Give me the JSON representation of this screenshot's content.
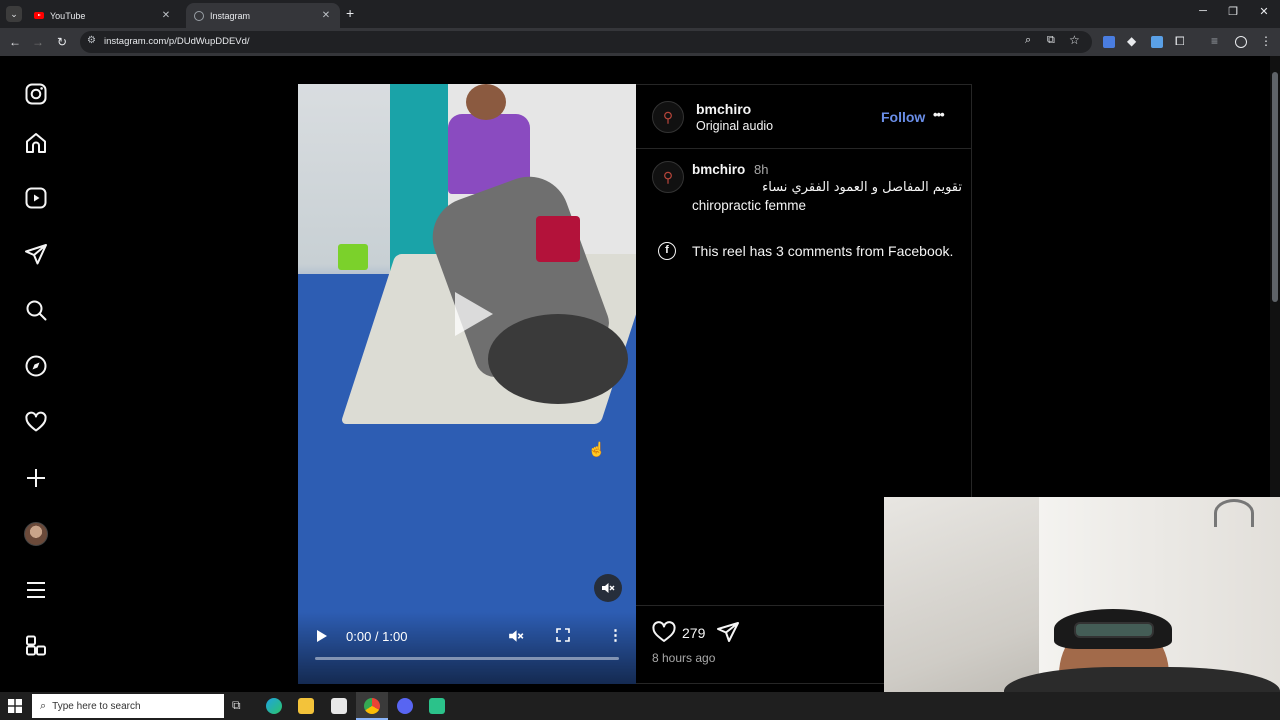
{
  "browser": {
    "tabs": [
      {
        "title": "YouTube"
      },
      {
        "title": "Instagram"
      }
    ],
    "url": "instagram.com/p/DUdWupDDEVd/",
    "new_tab_label": "+",
    "window_controls": {
      "minimize": "─",
      "restore": "❐",
      "close": "✕"
    }
  },
  "sidebar": {
    "icons": [
      "instagram-logo-icon",
      "home-icon",
      "reels-icon",
      "messages-icon",
      "search-icon",
      "explore-icon",
      "heart-icon",
      "create-icon",
      "profile-icon",
      "menu-icon",
      "apps-icon"
    ]
  },
  "video": {
    "time": "0:00 / 1:00",
    "progress": 0
  },
  "post": {
    "username": "bmchiro",
    "audio": "Original audio",
    "follow_label": "Follow",
    "more_label": "•••",
    "caption_user": "bmchiro",
    "caption_time": "8h",
    "caption_arabic": "تقويم المفاصل و العمود الفقري نساء",
    "caption_text": "chiropractic femme",
    "facebook_note": "This reel has 3 comments from Facebook.",
    "likes": "279",
    "posted_ago": "8 hours ago"
  },
  "taskbar": {
    "search_placeholder": "Type here to search"
  },
  "colors": {
    "follow": "#6a8ee8",
    "video_floor": "#2c5bb0",
    "chrome_dark": "#202124",
    "chrome_toolbar": "#35363a"
  }
}
